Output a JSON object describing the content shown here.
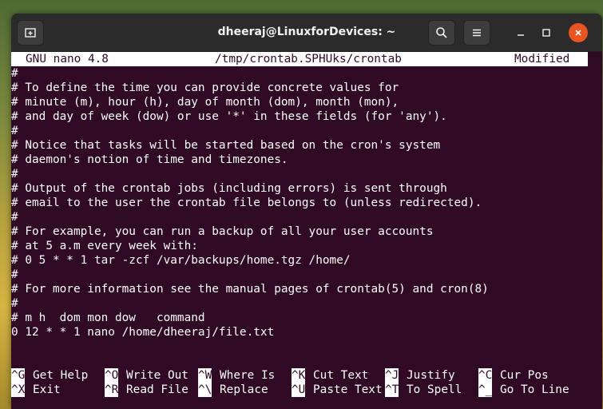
{
  "window": {
    "title": "dheeraj@LinuxforDevices: ~",
    "accent_close_color": "#e95420",
    "terminal_bg": "#300a24"
  },
  "nano": {
    "version": "GNU nano 4.8",
    "filename": "/tmp/crontab.SPHUks/crontab",
    "status": "Modified",
    "lines": [
      "#",
      "# To define the time you can provide concrete values for",
      "# minute (m), hour (h), day of month (dom), month (mon),",
      "# and day of week (dow) or use '*' in these fields (for 'any').",
      "#",
      "# Notice that tasks will be started based on the cron's system",
      "# daemon's notion of time and timezones.",
      "#",
      "# Output of the crontab jobs (including errors) is sent through",
      "# email to the user the crontab file belongs to (unless redirected).",
      "#",
      "# For example, you can run a backup of all your user accounts",
      "# at 5 a.m every week with:",
      "# 0 5 * * 1 tar -zcf /var/backups/home.tgz /home/",
      "#",
      "# For more information see the manual pages of crontab(5) and cron(8)",
      "#",
      "# m h  dom mon dow   command",
      "0 12 * * 1 nano /home/dheeraj/file.txt"
    ],
    "shortcuts": [
      {
        "key": "^G",
        "label": "Get Help"
      },
      {
        "key": "^O",
        "label": "Write Out"
      },
      {
        "key": "^W",
        "label": "Where Is"
      },
      {
        "key": "^K",
        "label": "Cut Text"
      },
      {
        "key": "^J",
        "label": "Justify"
      },
      {
        "key": "^C",
        "label": "Cur Pos"
      },
      {
        "key": "^X",
        "label": "Exit"
      },
      {
        "key": "^R",
        "label": "Read File"
      },
      {
        "key": "^\\",
        "label": "Replace"
      },
      {
        "key": "^U",
        "label": "Paste Text"
      },
      {
        "key": "^T",
        "label": "To Spell"
      },
      {
        "key": "^_",
        "label": "Go To Line"
      }
    ]
  },
  "icons": {
    "new_tab": "new-tab-icon",
    "search": "search-icon",
    "menu": "hamburger-menu-icon",
    "minimize": "minimize-icon",
    "maximize": "maximize-icon",
    "close": "close-icon"
  }
}
